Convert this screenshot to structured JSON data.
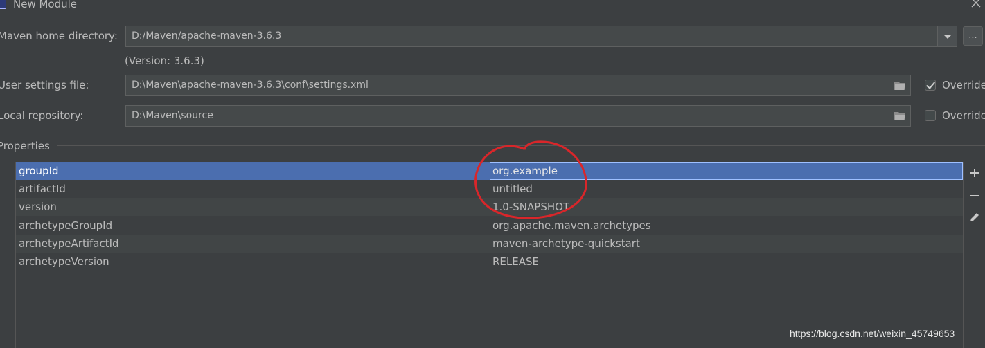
{
  "window": {
    "title": "New Module",
    "close_icon": "close-icon",
    "app_icon": "intellij-module-icon"
  },
  "maven_home": {
    "label": "Maven home directory:",
    "value": "D:/Maven/apache-maven-3.6.3",
    "browse_label": "...",
    "version_text": "(Version: 3.6.3)"
  },
  "user_settings": {
    "label": "User settings file:",
    "value": "D:\\Maven\\apache-maven-3.6.3\\conf\\settings.xml",
    "override_label": "Override",
    "override_checked": true
  },
  "local_repo": {
    "label": "Local repository:",
    "value": "D:\\Maven\\source",
    "override_label": "Override",
    "override_checked": false
  },
  "properties": {
    "section_label": "Properties",
    "rows": [
      {
        "key": "groupId",
        "value": "org.example",
        "selected": true
      },
      {
        "key": "artifactId",
        "value": "untitled"
      },
      {
        "key": "version",
        "value": "1.0-SNAPSHOT"
      },
      {
        "key": "archetypeGroupId",
        "value": "org.apache.maven.archetypes"
      },
      {
        "key": "archetypeArtifactId",
        "value": "maven-archetype-quickstart"
      },
      {
        "key": "archetypeVersion",
        "value": "RELEASE"
      }
    ],
    "actions": [
      "add-icon",
      "remove-icon",
      "edit-icon"
    ]
  },
  "watermark": "https://blog.csdn.net/weixin_45749653",
  "colors": {
    "background": "#3c3f41",
    "selection": "#4b6eaf",
    "annotation": "#d9262a"
  }
}
